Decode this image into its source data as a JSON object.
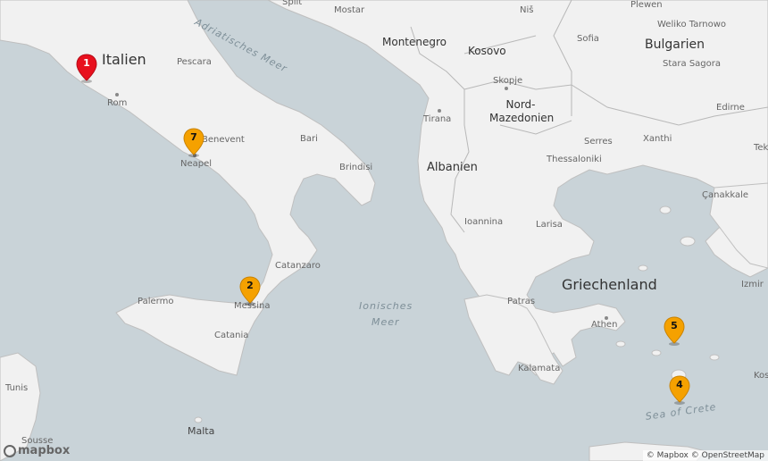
{
  "labels": {
    "countries": [
      "Italien",
      "Montenegro",
      "Kosovo",
      "Bulgarien",
      "Nord-Mazedonien",
      "Albanien",
      "Griechenland"
    ],
    "cities": [
      "Split",
      "Mostar",
      "Niš",
      "Plewen",
      "Weliko Tarnowo",
      "Sofia",
      "Stara Sagora",
      "Skopje",
      "Pescara",
      "Rom",
      "Benevent",
      "Neapel",
      "Bari",
      "Brindisi",
      "Tirana",
      "Serres",
      "Xanthi",
      "Edirne",
      "Thessaloniki",
      "Çanakkale",
      "Tekir",
      "Ioannina",
      "Larisa",
      "Catanzaro",
      "Palermo",
      "Messina",
      "Catania",
      "Patras",
      "Athen",
      "Izmir",
      "Kalamata",
      "Tunis",
      "Sousse",
      "Malta",
      "Kos"
    ],
    "seas": [
      "Adriatisches Meer",
      "Ionisches",
      "Meer",
      "Sea of Crete"
    ]
  },
  "markers": [
    {
      "label": "1",
      "color": "#e8101e"
    },
    {
      "label": "7",
      "color": "#f5a100"
    },
    {
      "label": "2",
      "color": "#f5a100"
    },
    {
      "label": "5",
      "color": "#f5a100"
    },
    {
      "label": "4",
      "color": "#f5a100"
    }
  ],
  "logo": "mapbox",
  "attribution": "© Mapbox © OpenStreetMap"
}
